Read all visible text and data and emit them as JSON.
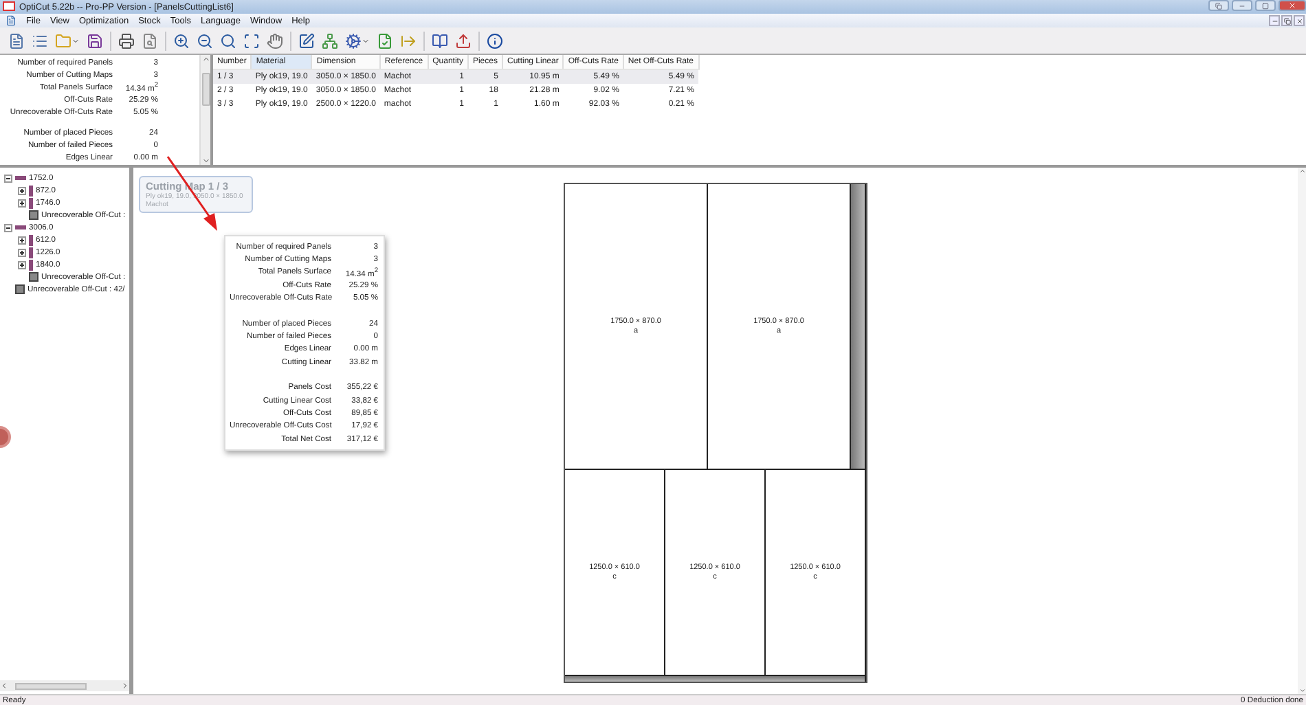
{
  "window": {
    "title": "OptiCut 5.22b -- Pro-PP Version - [PanelsCuttingList6]"
  },
  "menu": [
    "File",
    "View",
    "Optimization",
    "Stock",
    "Tools",
    "Language",
    "Window",
    "Help"
  ],
  "summary": {
    "groups": [
      [
        {
          "label": "Number of required Panels",
          "value": "3"
        },
        {
          "label": "Number of Cutting Maps",
          "value": "3"
        },
        {
          "label": "Total Panels Surface",
          "value": "14.34 m$^{2}$"
        },
        {
          "label": "Off-Cuts Rate",
          "value": "25.29 %"
        },
        {
          "label": "Unrecoverable Off-Cuts Rate",
          "value": "5.05 %"
        }
      ],
      [
        {
          "label": "Number of placed Pieces",
          "value": "24"
        },
        {
          "label": "Number of failed Pieces",
          "value": "0"
        },
        {
          "label": "Edges Linear",
          "value": "0.00 m"
        }
      ]
    ]
  },
  "table": {
    "columns": [
      {
        "label": "Number",
        "sorted": false
      },
      {
        "label": "Material",
        "sorted": true
      },
      {
        "label": "Dimension",
        "sorted": false
      },
      {
        "label": "Reference",
        "sorted": false
      },
      {
        "label": "Quantity",
        "sorted": false
      },
      {
        "label": "Pieces",
        "sorted": false
      },
      {
        "label": "Cutting Linear",
        "sorted": false
      },
      {
        "label": "Off-Cuts Rate",
        "sorted": false
      },
      {
        "label": "Net Off-Cuts Rate",
        "sorted": false
      }
    ],
    "rows": [
      {
        "selected": true,
        "cells": [
          "1 / 3",
          "Ply ok19, 19.0",
          "3050.0 × 1850.0",
          "Machot",
          "1",
          "5",
          "10.95 m",
          "5.49 %",
          "5.49 %"
        ]
      },
      {
        "selected": false,
        "cells": [
          "2 / 3",
          "Ply ok19, 19.0",
          "3050.0 × 1850.0",
          "Machot",
          "1",
          "18",
          "21.28 m",
          "9.02 %",
          "7.21 %"
        ]
      },
      {
        "selected": false,
        "cells": [
          "3 / 3",
          "Ply ok19, 19.0",
          "2500.0 × 1220.0",
          "machot",
          "1",
          "1",
          "1.60 m",
          "92.03 %",
          "0.21 %"
        ]
      }
    ]
  },
  "tree": [
    {
      "label": "1752.0",
      "kind": "strip",
      "expanded": true,
      "children": [
        {
          "label": "872.0",
          "kind": "piece",
          "expanded": false
        },
        {
          "label": "1746.0",
          "kind": "piece",
          "expanded": false
        },
        {
          "label": "Unrecoverable Off-Cut :",
          "kind": "offcut"
        }
      ]
    },
    {
      "label": "3006.0",
      "kind": "strip",
      "expanded": true,
      "children": [
        {
          "label": "612.0",
          "kind": "piece",
          "expanded": false
        },
        {
          "label": "1226.0",
          "kind": "piece",
          "expanded": false
        },
        {
          "label": "1840.0",
          "kind": "piece",
          "expanded": false
        },
        {
          "label": "Unrecoverable Off-Cut :",
          "kind": "offcut"
        }
      ]
    },
    {
      "label": "Unrecoverable Off-Cut : 42/",
      "kind": "offcut"
    }
  ],
  "map_card": {
    "title": "Cutting Map 1 / 3",
    "material": "Ply ok19, 19.0, 3050.0 × 1850.0",
    "reference": "Machot"
  },
  "popover": {
    "groups": [
      [
        {
          "label": "Number of required Panels",
          "value": "3"
        },
        {
          "label": "Number of Cutting Maps",
          "value": "3"
        },
        {
          "label": "Total Panels Surface",
          "value": "14.34 m$^{2}$"
        },
        {
          "label": "Off-Cuts Rate",
          "value": "25.29 %"
        },
        {
          "label": "Unrecoverable Off-Cuts Rate",
          "value": "5.05 %"
        }
      ],
      [
        {
          "label": "Number of placed Pieces",
          "value": "24"
        },
        {
          "label": "Number of failed Pieces",
          "value": "0"
        },
        {
          "label": "Edges Linear",
          "value": "0.00 m"
        },
        {
          "label": "Cutting Linear",
          "value": "33.82 m"
        }
      ],
      [
        {
          "label": "Panels Cost",
          "value": "355,22 €"
        },
        {
          "label": "Cutting Linear Cost",
          "value": "33,82 €"
        },
        {
          "label": "Off-Cuts Cost",
          "value": "89,85 €"
        },
        {
          "label": "Unrecoverable Off-Cuts Cost",
          "value": "17,92 €"
        },
        {
          "label": "Total Net Cost",
          "value": "317,12 €"
        }
      ]
    ]
  },
  "sheet": {
    "rows": [
      {
        "kind": "pieces",
        "items": [
          {
            "kind": "piece",
            "dimension": "1750.0 × 870.0",
            "label": "a"
          },
          {
            "kind": "piece",
            "dimension": "1750.0 × 870.0",
            "label": "a"
          },
          {
            "kind": "offcut"
          }
        ]
      },
      {
        "kind": "pieces",
        "items": [
          {
            "kind": "piece",
            "dimension": "1250.0 × 610.0",
            "label": "c"
          },
          {
            "kind": "piece",
            "dimension": "1250.0 × 610.0",
            "label": "c"
          },
          {
            "kind": "piece",
            "dimension": "1250.0 × 610.0",
            "label": "c"
          }
        ]
      },
      {
        "kind": "offcut"
      }
    ]
  },
  "status_bar": {
    "left": "Ready",
    "right": "0 Deduction done"
  }
}
